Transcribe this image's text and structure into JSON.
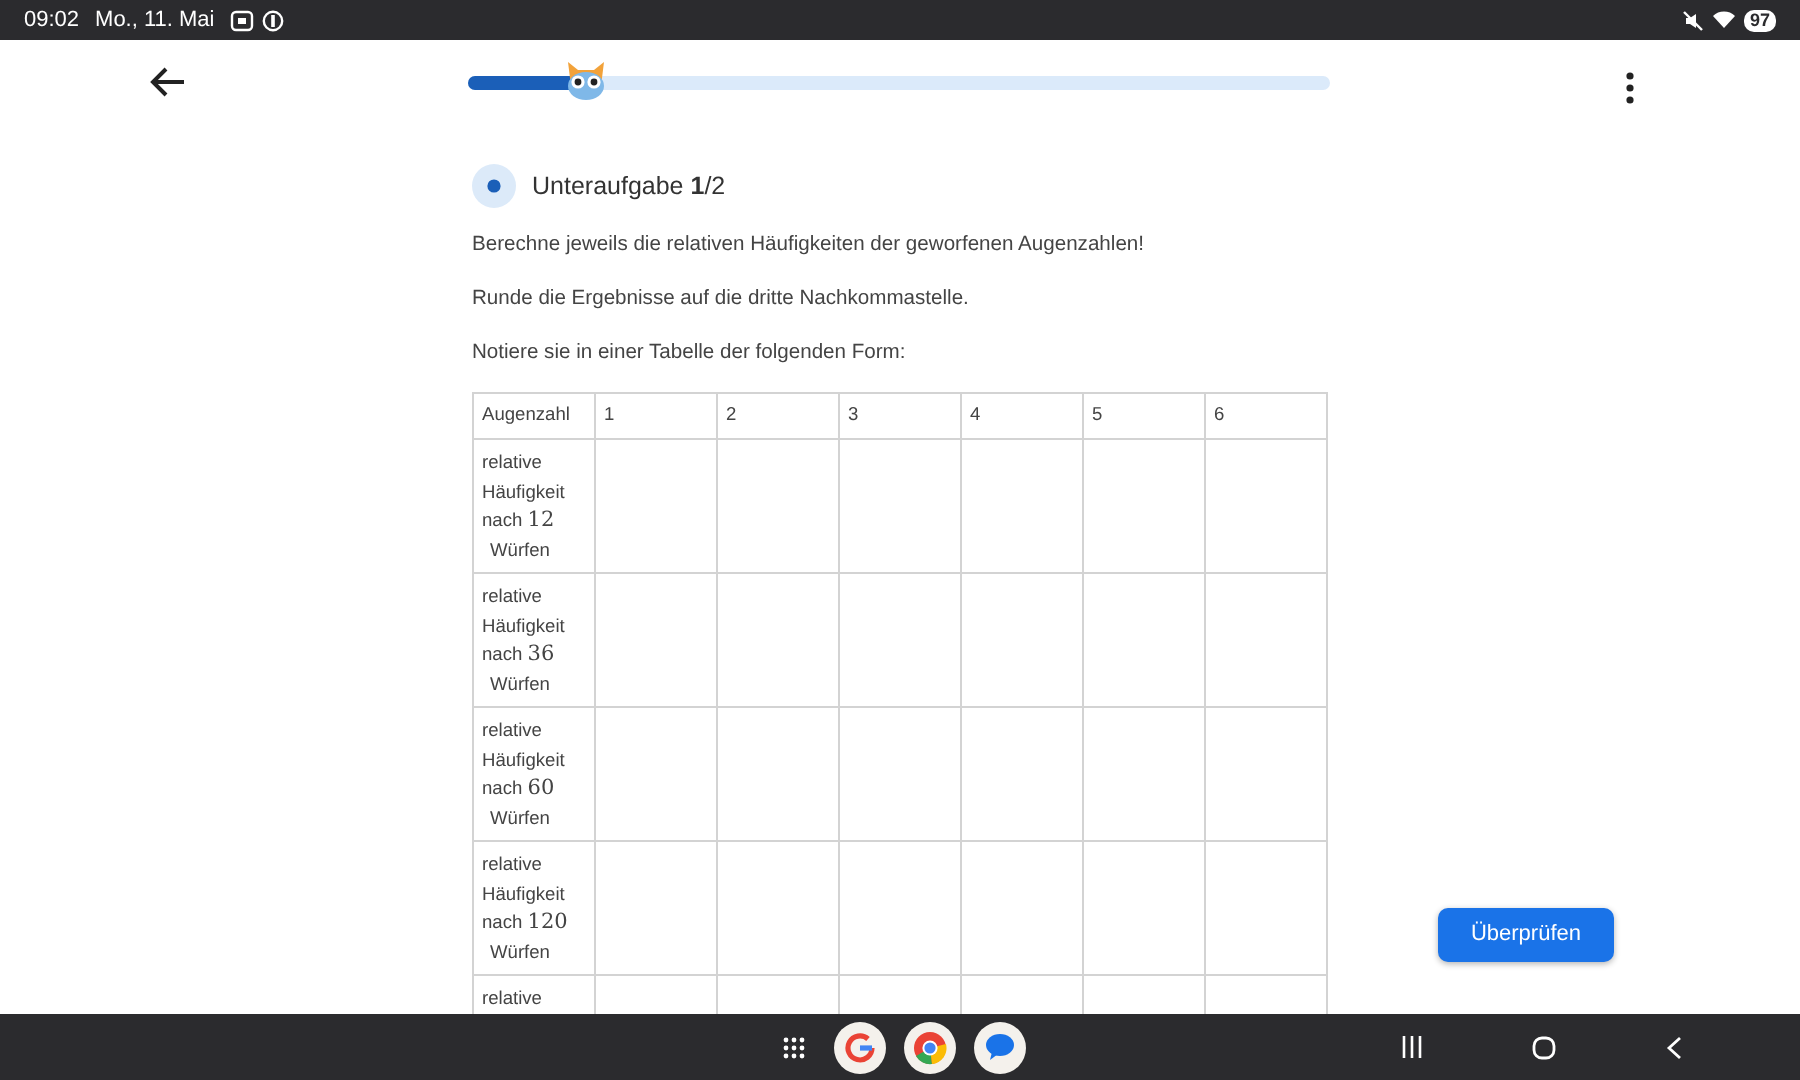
{
  "status_bar": {
    "time": "09:02",
    "date": "Mo., 11. Mai",
    "battery": "97"
  },
  "top_bar": {
    "progress": {
      "level": 0.14
    }
  },
  "task": {
    "title": "Unteraufgabe **1**/2",
    "paragraphs": [
      "Berechne jeweils die relativen Häufigkeiten der geworfenen Augenzahlen!",
      "Runde die Ergebnisse auf die dritte Nachkommastelle.",
      "Notiere sie in einer Tabelle der folgenden Form:"
    ]
  },
  "table": {
    "columns": [
      "Augenzahl",
      "1",
      "2",
      "3",
      "4",
      "5",
      "6"
    ],
    "rows": [
      {
        "label_before": "relative Häufigkeit nach",
        "number": "12",
        "label_after": "Würfen"
      },
      {
        "label_before": "relative Häufigkeit nach",
        "number": "36",
        "label_after": "Würfen"
      },
      {
        "label_before": "relative Häufigkeit nach",
        "number": "60",
        "label_after": "Würfen"
      },
      {
        "label_before": "relative Häufigkeit nach",
        "number": "120",
        "label_after": "Würfen"
      },
      {
        "label_before": "relative"
      }
    ]
  },
  "check_button": "Überprüfen"
}
